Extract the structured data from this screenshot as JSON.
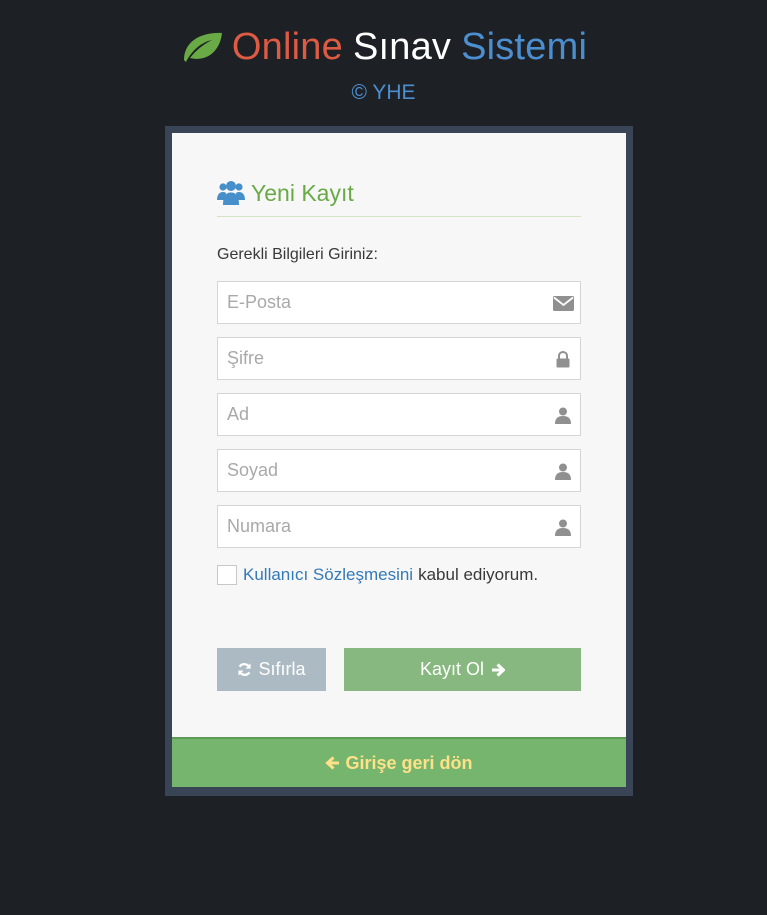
{
  "header": {
    "title_word1": "Online",
    "title_word2": "Sınav",
    "title_word3": "Sistemi",
    "subtitle": "© YHE",
    "colors": {
      "word1": "#dd5a43",
      "word2": "#ffffff",
      "word3": "#4c8fd0",
      "leaf": "#69aa46"
    }
  },
  "form": {
    "heading": "Yeni Kayıt",
    "heading_icon": "users-icon",
    "prompt": "Gerekli Bilgileri Giriniz:",
    "fields": [
      {
        "placeholder": "E-Posta",
        "value": "",
        "icon": "envelope-icon"
      },
      {
        "placeholder": "Şifre",
        "value": "",
        "icon": "lock-icon"
      },
      {
        "placeholder": "Ad",
        "value": "",
        "icon": "user-icon"
      },
      {
        "placeholder": "Soyad",
        "value": "",
        "icon": "user-icon"
      },
      {
        "placeholder": "Numara",
        "value": "",
        "icon": "user-icon"
      }
    ],
    "agreement": {
      "checked": false,
      "link_text": "Kullanıcı Sözleşmesini",
      "rest_text": "kabul ediyorum."
    },
    "reset_label": "Sıfırla",
    "submit_label": "Kayıt Ol"
  },
  "footer": {
    "back_label": "Girişe geri dön",
    "back_icon": "arrow-left-icon"
  }
}
